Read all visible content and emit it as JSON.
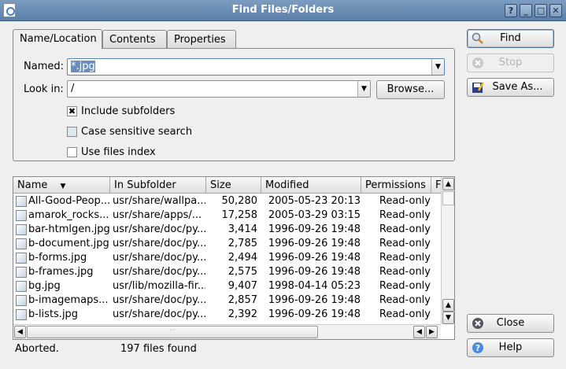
{
  "window": {
    "title": "Find Files/Folders",
    "help": "?",
    "minimize": "_",
    "maximize": "□",
    "close": "✕"
  },
  "tabs": [
    {
      "label": "Name/Location"
    },
    {
      "label": "Contents"
    },
    {
      "label": "Properties"
    }
  ],
  "form": {
    "named_label": "Named:",
    "named_value": "*.jpg",
    "lookin_label": "Look in:",
    "lookin_value": "/",
    "browse_label": "Browse...",
    "checkboxes": [
      {
        "label": "Include subfolders",
        "checked": true
      },
      {
        "label": "Case sensitive search",
        "checked": false
      },
      {
        "label": "Use files index",
        "checked": false
      }
    ]
  },
  "buttons": {
    "find": "Find",
    "stop": "Stop",
    "save_as": "Save As...",
    "close": "Close",
    "help": "Help"
  },
  "list": {
    "columns": [
      "Name",
      "In Subfolder",
      "Size",
      "Modified",
      "Permissions",
      "F"
    ],
    "rows": [
      [
        "All-Good-Peop...",
        "usr/share/wallpa...",
        "50,280",
        "2005-05-23 20:13",
        "Read-only"
      ],
      [
        "amarok_rocks...",
        "usr/share/apps/...",
        "17,258",
        "2005-03-29 03:15",
        "Read-only"
      ],
      [
        "bar-htmlgen.jpg",
        "usr/share/doc/py...",
        "3,414",
        "1996-09-26 19:48",
        "Read-only"
      ],
      [
        "b-document.jpg",
        "usr/share/doc/py...",
        "2,785",
        "1996-09-26 19:48",
        "Read-only"
      ],
      [
        "b-forms.jpg",
        "usr/share/doc/py...",
        "2,494",
        "1996-09-26 19:48",
        "Read-only"
      ],
      [
        "b-frames.jpg",
        "usr/share/doc/py...",
        "2,575",
        "1996-09-26 19:48",
        "Read-only"
      ],
      [
        "bg.jpg",
        "usr/lib/mozilla-fir...",
        "9,407",
        "1998-04-14 05:23",
        "Read-only"
      ],
      [
        "b-imagemaps....",
        "usr/share/doc/py...",
        "2,857",
        "1996-09-26 19:48",
        "Read-only"
      ],
      [
        "b-lists.jpg",
        "usr/share/doc/py...",
        "2,392",
        "1996-09-26 19:48",
        "Read-only"
      ]
    ]
  },
  "status": {
    "state": "Aborted.",
    "count": "197 files found"
  }
}
